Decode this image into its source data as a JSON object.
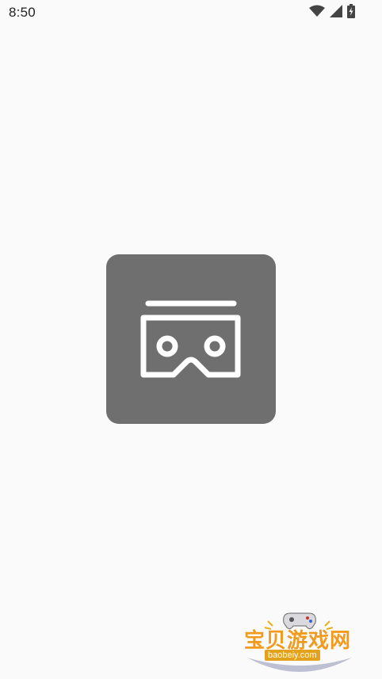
{
  "status_bar": {
    "time": "8:50",
    "icons": [
      "wifi-icon",
      "cell-signal-icon",
      "battery-charging-icon"
    ]
  },
  "splash": {
    "icon": "vr-headset-icon",
    "card_color": "#6f6f6f",
    "icon_color": "#ffffff"
  },
  "watermark": {
    "title": "宝贝游戏网",
    "url": "baobeiy.com",
    "icon": "gamepad-icon",
    "title_color": "#f29a1d"
  },
  "background_color": "#fafafa"
}
